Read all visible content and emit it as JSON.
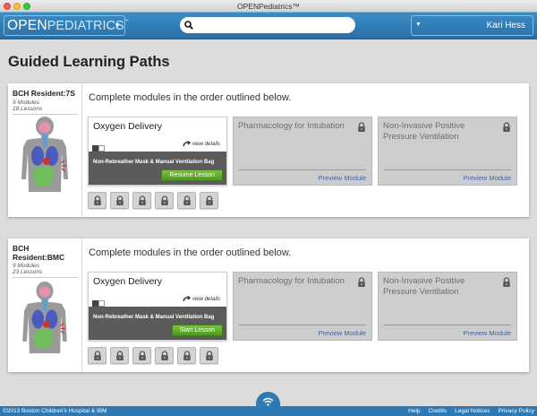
{
  "window": {
    "title": "OPENPediatrics™"
  },
  "header": {
    "logo_open": "OPEN",
    "logo_pediatrics": "PEDIATRICS",
    "logo_tm": "™",
    "search_placeholder": "",
    "user_name": "Kari Hess"
  },
  "page": {
    "title": "Guided Learning Paths"
  },
  "paths": [
    {
      "resident": "BCH Resident:7S",
      "modules_count": "9 Modules",
      "lessons_count": "18 Lessons",
      "instruction": "Complete modules in the order outlined below.",
      "active_module": {
        "title": "Oxygen Delivery",
        "details_label": "view details",
        "lesson_name": "Non-Rebreather Mask & Manual Ventilation Bag",
        "button_label": "Resume Lesson"
      },
      "locked_modules": [
        {
          "title": "Pharmacology for Intubation",
          "preview_label": "Preview Module"
        },
        {
          "title": "Non-Invasive Positive Pressure Ventilation",
          "preview_label": "Preview Module"
        }
      ]
    },
    {
      "resident": "BCH Resident:BMC",
      "modules_count": "9 Modules",
      "lessons_count": "23 Lessons",
      "instruction": "Complete modules in the order outlined below.",
      "active_module": {
        "title": "Oxygen Delivery",
        "details_label": "view details",
        "lesson_name": "Non-Rebreather Mask & Manual Ventilation Bag",
        "button_label": "Start Lesson"
      },
      "locked_modules": [
        {
          "title": "Pharmacology for Intubation",
          "preview_label": "Preview Module"
        },
        {
          "title": "Non-Invasive Positive Pressure Ventilation",
          "preview_label": "Preview Module"
        }
      ]
    }
  ],
  "footer": {
    "copyright": "©2013 Boston Children's Hospital & IBM",
    "links": [
      "Help",
      "Credits",
      "Legal Notices",
      "Privacy Policy"
    ]
  },
  "icons": {
    "search": "search-icon",
    "lock": "lock-icon",
    "curved_arrow": "curved-arrow-icon",
    "wifi": "wifi-icon",
    "dropdown": "caret-down-icon"
  },
  "colors": {
    "header_blue": "#2f7cb8",
    "button_green": "#5fab2c",
    "link_blue": "#3a5fc6",
    "locked_gray": "#cdcdcd"
  }
}
